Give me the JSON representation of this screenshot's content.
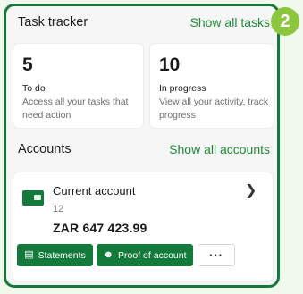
{
  "task_tracker": {
    "title": "Task tracker",
    "show_all": "Show all tasks",
    "todo": {
      "count": "5",
      "label": "To do",
      "description": "Access all your tasks that need action"
    },
    "in_progress": {
      "count": "10",
      "label": "In progress",
      "description": "View all your activity, track progress"
    }
  },
  "step_badge": "2",
  "accounts": {
    "title": "Accounts",
    "show_all": "Show all accounts",
    "account": {
      "name": "Current account",
      "number": "12",
      "balance": "ZAR 647 423.99",
      "icon": "bank-card-icon"
    },
    "buttons": {
      "statements": "Statements",
      "proof": "Proof of account",
      "more": "···"
    }
  },
  "colors": {
    "brand_green": "#137a3c",
    "link_green": "#1f8a3a",
    "badge_green": "#8bc63e",
    "page_background": "#f1f8ec"
  }
}
